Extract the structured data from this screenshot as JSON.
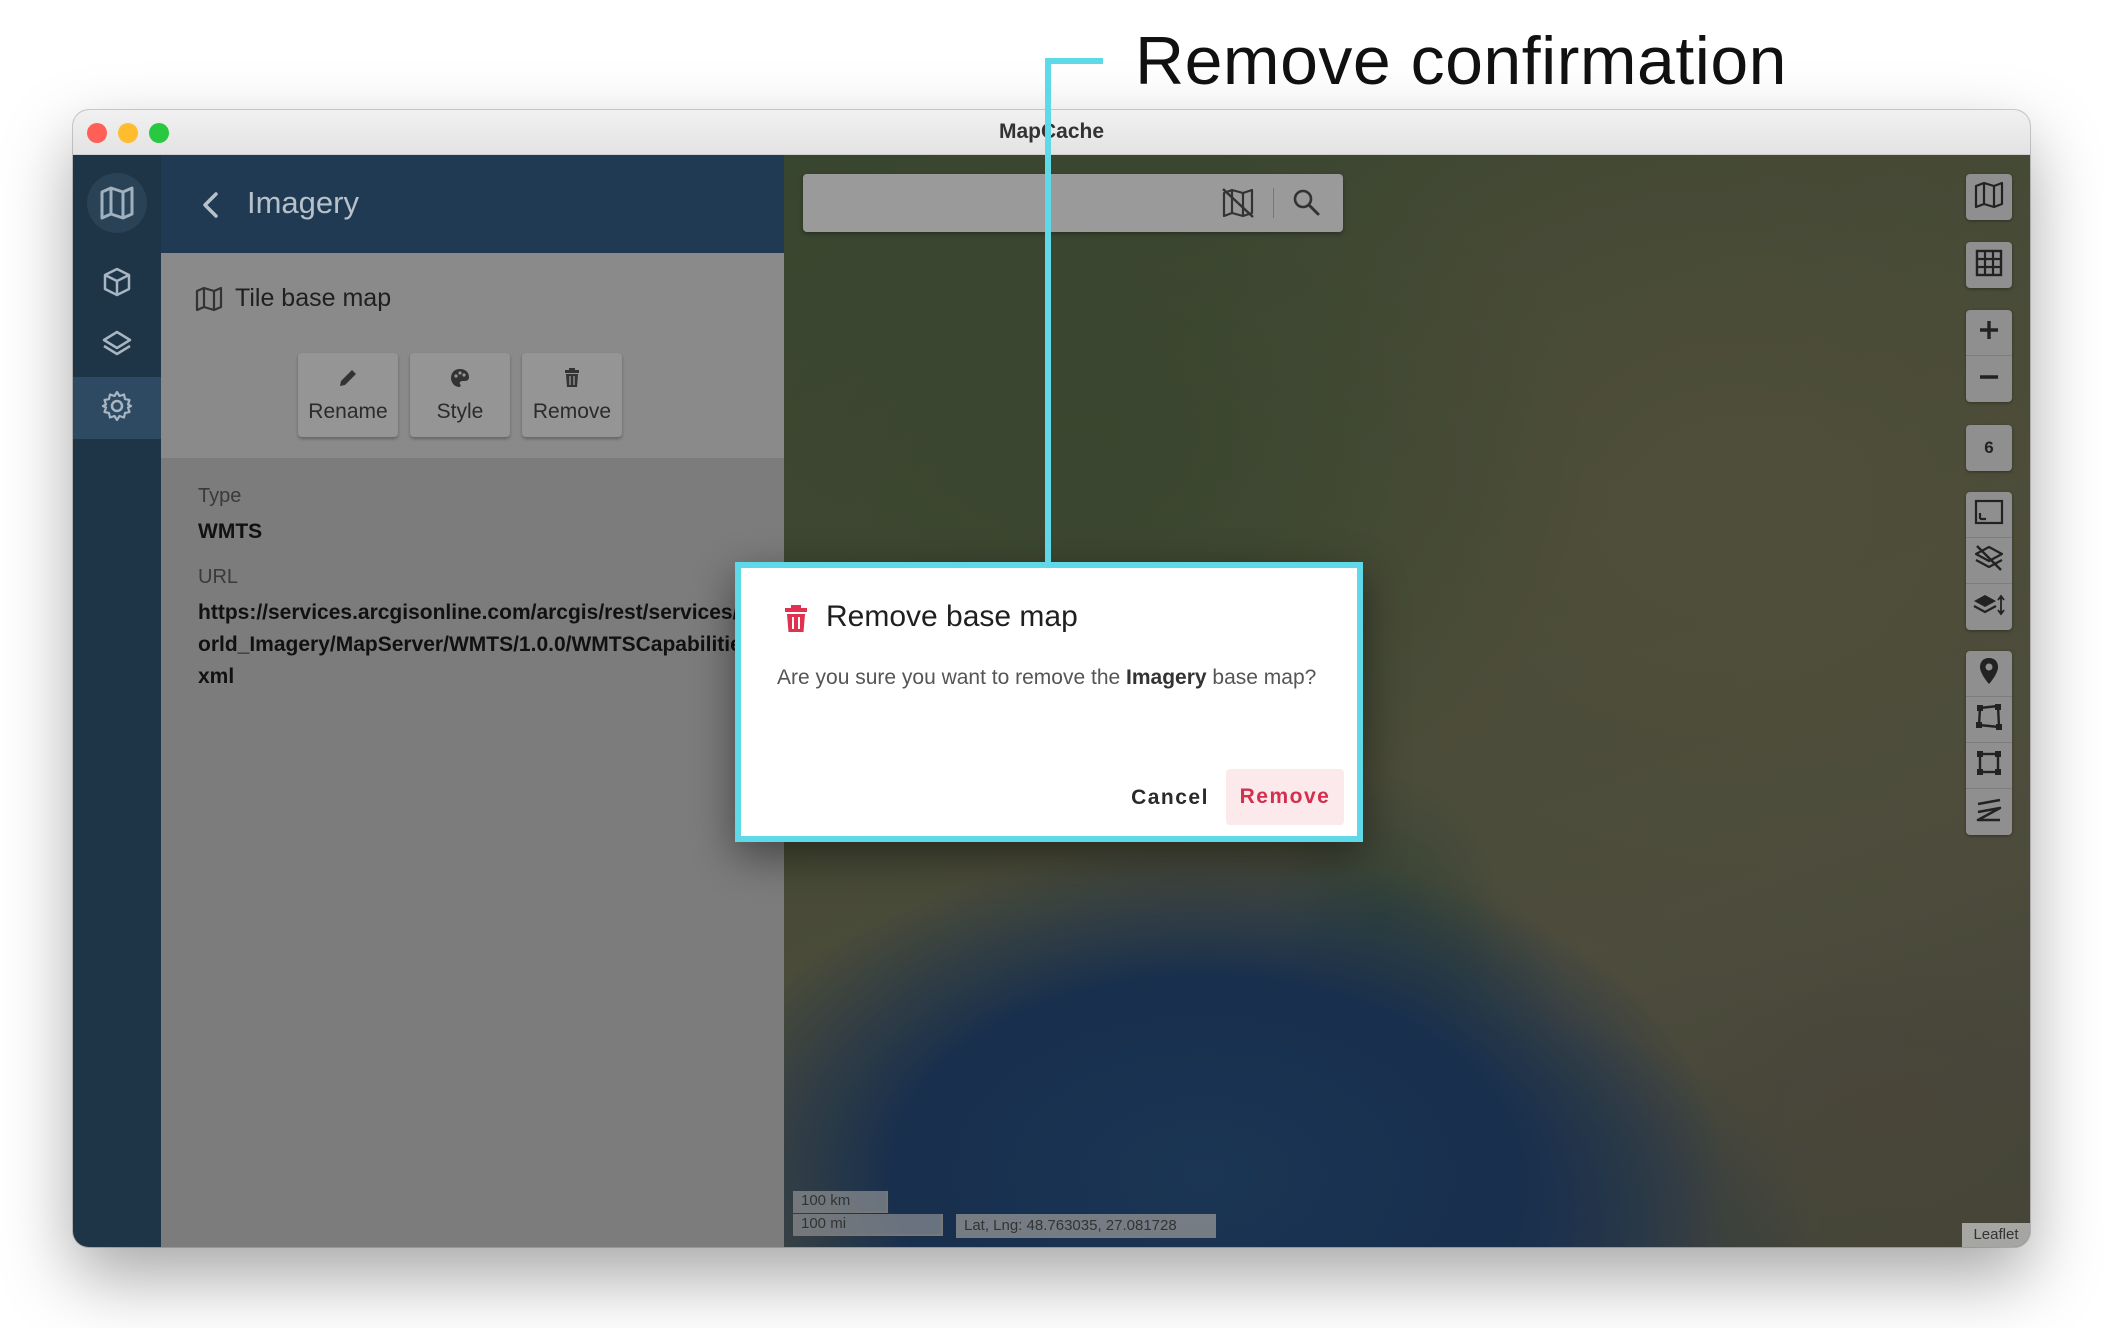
{
  "annotation": {
    "title": "Remove confirmation",
    "accent_color": "#5fd9e8"
  },
  "window": {
    "title": "MapCache"
  },
  "rail": {
    "items": [
      {
        "icon": "map-logo-icon"
      },
      {
        "icon": "cube-icon"
      },
      {
        "icon": "layers-icon"
      },
      {
        "icon": "gear-icon",
        "active": true
      }
    ]
  },
  "panel": {
    "title": "Imagery",
    "card_title": "Tile base map",
    "actions": {
      "rename": "Rename",
      "style": "Style",
      "remove": "Remove"
    },
    "type_label": "Type",
    "type_value": "WMTS",
    "url_label": "URL",
    "url_value": "https://services.arcgisonline.com/arcgis/rest/services/World_Imagery/MapServer/WMTS/1.0.0/WMTSCapabilities.xml"
  },
  "map": {
    "zoom_level": "6",
    "scale_km": "100 km",
    "scale_mi": "100 mi",
    "coordinates": "Lat, Lng: 48.763035, 27.081728",
    "attribution": "Leaflet"
  },
  "dialog": {
    "title": "Remove base map",
    "text_before": "Are you sure you want to remove the ",
    "text_bold": "Imagery",
    "text_after": " base map?",
    "cancel_label": "Cancel",
    "remove_label": "Remove",
    "danger_color": "#d32f4f"
  }
}
